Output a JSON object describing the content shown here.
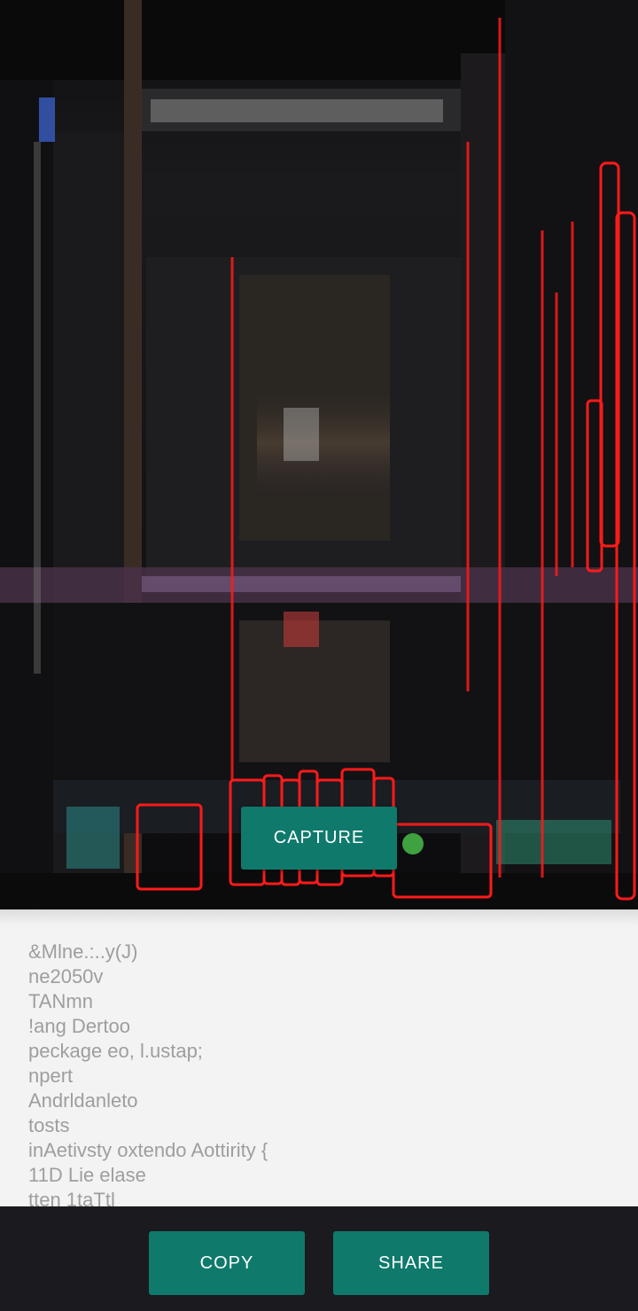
{
  "camera": {
    "capture_label": "CAPTURE"
  },
  "recognized_text": {
    "lines": [
      "&Mlne.:..y(J)",
      "ne2050v",
      "TANmn",
      "!ang Dertoo",
      "peckage eo, l.ustap;",
      "npert",
      "Andrldanleto",
      "tosts",
      "inAetivsty oxtendo Aottirity {",
      "11D Lie elase",
      "tten 1taTtl"
    ]
  },
  "actions": {
    "copy_label": "COPY",
    "share_label": "SHARE"
  },
  "colors": {
    "accent": "#0f7a6c",
    "text_area_bg": "#f3f3f3",
    "ocr_text": "#9e9e9e",
    "bottom_bar_bg": "#1b1a1f",
    "detection_box": "#ff1a1a"
  }
}
